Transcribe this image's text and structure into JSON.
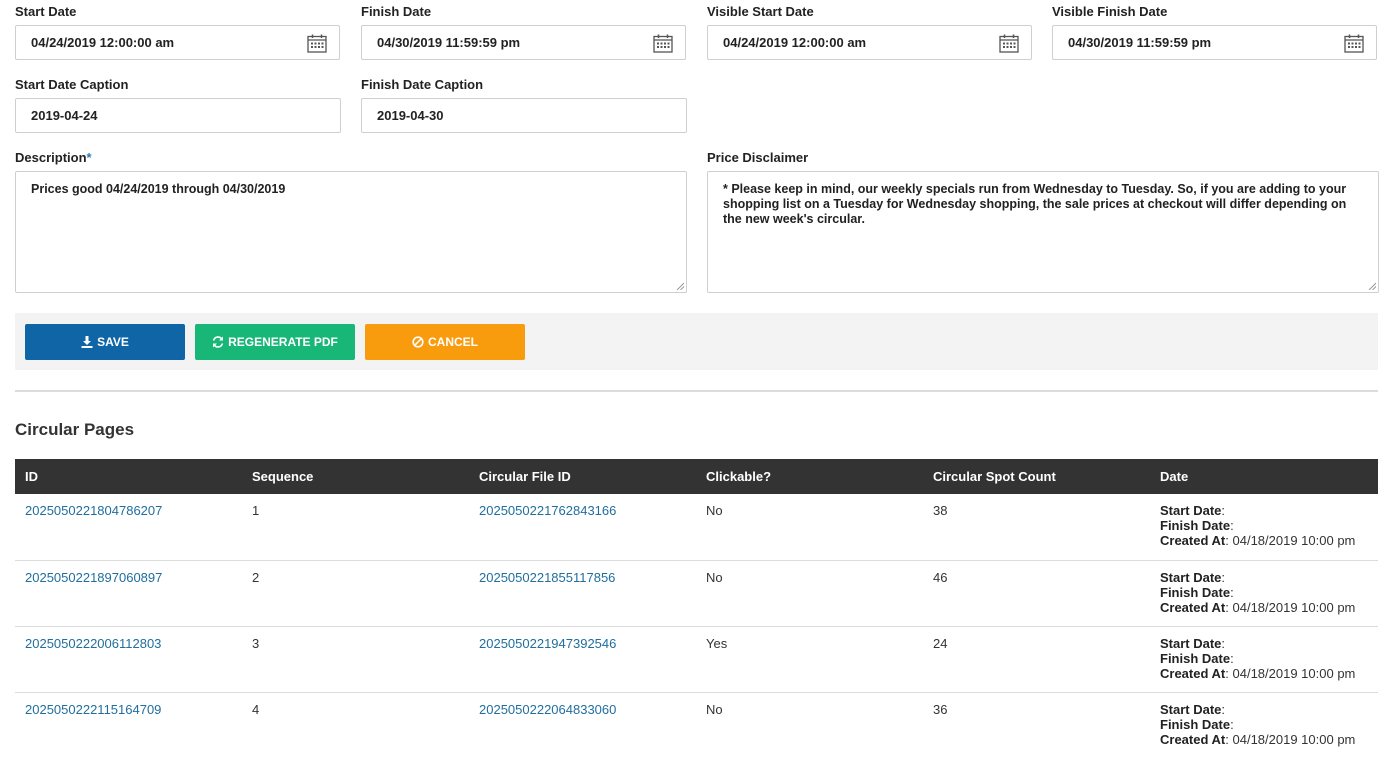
{
  "form": {
    "start_date": {
      "label": "Start Date",
      "value": "04/24/2019 12:00:00 am"
    },
    "finish_date": {
      "label": "Finish Date",
      "value": "04/30/2019 11:59:59 pm"
    },
    "visible_start_date": {
      "label": "Visible Start Date",
      "value": "04/24/2019 12:00:00 am"
    },
    "visible_finish_date": {
      "label": "Visible Finish Date",
      "value": "04/30/2019 11:59:59 pm"
    },
    "start_date_caption": {
      "label": "Start Date Caption",
      "value": "2019-04-24"
    },
    "finish_date_caption": {
      "label": "Finish Date Caption",
      "value": "2019-04-30"
    },
    "description": {
      "label": "Description",
      "required_mark": "*",
      "value": "Prices good 04/24/2019 through 04/30/2019"
    },
    "price_disclaimer": {
      "label": "Price Disclaimer",
      "value": "* Please keep in mind, our weekly specials run from Wednesday to Tuesday. So, if you are adding to your shopping list on a Tuesday for Wednesday shopping, the sale prices at checkout will differ depending on the new week's circular."
    }
  },
  "buttons": {
    "save": {
      "label": "SAVE",
      "icon": "download-icon",
      "color": "#0f65a6"
    },
    "regenerate": {
      "label": "REGENERATE PDF",
      "icon": "refresh-icon",
      "color": "#18b777"
    },
    "cancel": {
      "label": "CANCEL",
      "icon": "ban-icon",
      "color": "#f89c0e"
    }
  },
  "circular_pages": {
    "title": "Circular Pages",
    "columns": [
      "ID",
      "Sequence",
      "Circular File ID",
      "Clickable?",
      "Circular Spot Count",
      "Date"
    ],
    "date_labels": {
      "start": "Start Date",
      "finish": "Finish Date",
      "created": "Created At"
    },
    "rows": [
      {
        "id": "2025050221804786207",
        "sequence": "1",
        "file_id": "2025050221762843166",
        "clickable": "No",
        "spot_count": "38",
        "created_at": "04/18/2019 10:00 pm"
      },
      {
        "id": "2025050221897060897",
        "sequence": "2",
        "file_id": "2025050221855117856",
        "clickable": "No",
        "spot_count": "46",
        "created_at": "04/18/2019 10:00 pm"
      },
      {
        "id": "2025050222006112803",
        "sequence": "3",
        "file_id": "2025050221947392546",
        "clickable": "Yes",
        "spot_count": "24",
        "created_at": "04/18/2019 10:00 pm"
      },
      {
        "id": "2025050222115164709",
        "sequence": "4",
        "file_id": "2025050222064833060",
        "clickable": "No",
        "spot_count": "36",
        "created_at": "04/18/2019 10:00 pm"
      }
    ]
  }
}
